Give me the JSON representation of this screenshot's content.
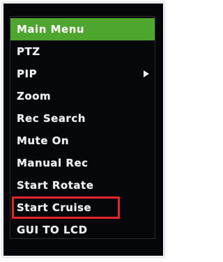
{
  "menu": {
    "title": "Main Menu",
    "items": [
      {
        "label": "PTZ"
      },
      {
        "label": "PIP",
        "has_submenu": true
      },
      {
        "label": "Zoom"
      },
      {
        "label": "Rec Search"
      },
      {
        "label": "Mute On"
      },
      {
        "label": "Manual Rec"
      },
      {
        "label": "Start Rotate"
      },
      {
        "label": "Start Cruise",
        "highlighted": true
      },
      {
        "label": "GUI TO LCD"
      }
    ]
  },
  "colors": {
    "selected_bg": "#4fa62f",
    "highlight_border": "#e3262a",
    "menu_bg": "#05070b"
  }
}
